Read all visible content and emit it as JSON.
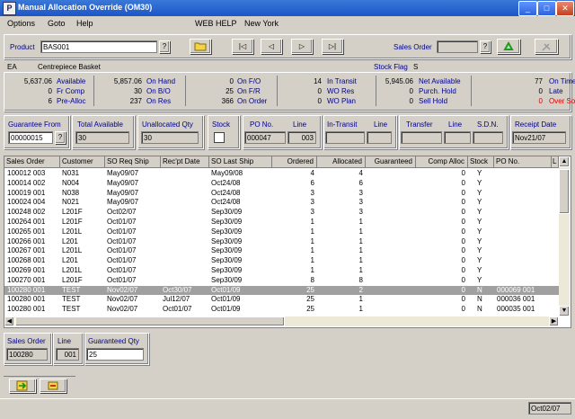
{
  "window": {
    "title": "Manual Allocation Override (OM30)",
    "icon_letter": "P",
    "minimize_glyph": "_",
    "maximize_glyph": "□",
    "close_glyph": "✕"
  },
  "menu": {
    "items": [
      "Options",
      "Goto",
      "Help"
    ],
    "web_help": "WEB HELP",
    "location": "New York"
  },
  "product": {
    "label": "Product",
    "value": "BAS001",
    "lookup": "?",
    "uom": "EA",
    "description": "Centrepiece Basket",
    "stock_flag_label": "Stock Flag",
    "stock_flag_value": "S"
  },
  "sales_order_lookup": {
    "label": "Sales Order",
    "value": "",
    "lookup": "?"
  },
  "nav": {
    "first": "|◁",
    "prev": "◁",
    "next": "▷",
    "last": "▷|"
  },
  "stats": {
    "col1": [
      {
        "value": "5,637.06",
        "label": "Available"
      },
      {
        "value": "0",
        "label": "Fr Comp"
      },
      {
        "value": "6",
        "label": "Pre-Alloc"
      }
    ],
    "col2": [
      {
        "value": "5,857.06",
        "label": "On Hand"
      },
      {
        "value": "30",
        "label": "On B/O"
      },
      {
        "value": "237",
        "label": "On Res"
      }
    ],
    "col3": [
      {
        "value": "0",
        "label": "On F/O"
      },
      {
        "value": "25",
        "label": "On F/R"
      },
      {
        "value": "366",
        "label": "On Order"
      }
    ],
    "col4": [
      {
        "value": "14",
        "label": "In Transit"
      },
      {
        "value": "0",
        "label": "WO Res"
      },
      {
        "value": "0",
        "label": "WO Plan"
      }
    ],
    "col5": [
      {
        "value": "5,945.06",
        "label": "Net Available"
      },
      {
        "value": "0",
        "label": "Purch. Hold"
      },
      {
        "value": "0",
        "label": "Sell Hold"
      }
    ],
    "col6": [
      {
        "value": "77",
        "label": "On Time"
      },
      {
        "value": "0",
        "label": "Late"
      },
      {
        "value": "0",
        "label": "Over Sold"
      }
    ]
  },
  "details": {
    "guarantee_from": {
      "label": "Guarantee From",
      "value": "00000015",
      "lookup": "?"
    },
    "total_available": {
      "label": "Total Available",
      "value": "30"
    },
    "unallocated_qty": {
      "label": "Unallocated Qty",
      "value": "30"
    },
    "stock": {
      "label": "Stock"
    },
    "po_no": {
      "label": "PO No.",
      "value": "000047"
    },
    "po_line": {
      "label": "Line",
      "value": "003"
    },
    "in_transit": {
      "label": "In-Transit",
      "value": ""
    },
    "in_transit_line": {
      "label": "Line",
      "value": ""
    },
    "transfer": {
      "label": "Transfer",
      "value": ""
    },
    "transfer_line": {
      "label": "Line",
      "value": ""
    },
    "sdn": {
      "label": "S.D.N.",
      "value": ""
    },
    "receipt_date": {
      "label": "Receipt Date",
      "value": "Nov21/07"
    }
  },
  "table": {
    "columns": [
      "Sales Order",
      "Customer",
      "SO Req Ship",
      "Rec'pt Date",
      "SO Last Ship",
      "Ordered",
      "Allocated",
      "Guaranteed",
      "Comp Alloc",
      "Stock",
      "PO No.",
      "L"
    ],
    "rows": [
      [
        "100012  003",
        "N031",
        "May09/07",
        "",
        "May09/08",
        "4",
        "4",
        "",
        "0",
        "Y",
        ""
      ],
      [
        "100014  002",
        "N004",
        "May09/07",
        "",
        "Oct24/08",
        "6",
        "6",
        "",
        "0",
        "Y",
        ""
      ],
      [
        "100019  001",
        "N038",
        "May09/07",
        "",
        "Oct24/08",
        "3",
        "3",
        "",
        "0",
        "Y",
        ""
      ],
      [
        "100024  004",
        "N021",
        "May09/07",
        "",
        "Oct24/08",
        "3",
        "3",
        "",
        "0",
        "Y",
        ""
      ],
      [
        "100248  002",
        "L201F",
        "Oct02/07",
        "",
        "Sep30/09",
        "3",
        "3",
        "",
        "0",
        "Y",
        ""
      ],
      [
        "100264  001",
        "L201F",
        "Oct01/07",
        "",
        "Sep30/09",
        "1",
        "1",
        "",
        "0",
        "Y",
        ""
      ],
      [
        "100265  001",
        "L201L",
        "Oct01/07",
        "",
        "Sep30/09",
        "1",
        "1",
        "",
        "0",
        "Y",
        ""
      ],
      [
        "100266  001",
        "L201",
        "Oct01/07",
        "",
        "Sep30/09",
        "1",
        "1",
        "",
        "0",
        "Y",
        ""
      ],
      [
        "100267  001",
        "L201L",
        "Oct01/07",
        "",
        "Sep30/09",
        "1",
        "1",
        "",
        "0",
        "Y",
        ""
      ],
      [
        "100268  001",
        "L201",
        "Oct01/07",
        "",
        "Sep30/09",
        "1",
        "1",
        "",
        "0",
        "Y",
        ""
      ],
      [
        "100269  001",
        "L201L",
        "Oct01/07",
        "",
        "Sep30/09",
        "1",
        "1",
        "",
        "0",
        "Y",
        ""
      ],
      [
        "100270  001",
        "L201F",
        "Oct01/07",
        "",
        "Sep30/09",
        "8",
        "8",
        "",
        "0",
        "Y",
        ""
      ],
      [
        "100280  001",
        "TEST",
        "Nov02/07",
        "Oct30/07",
        "Oct01/09",
        "25",
        "2",
        "",
        "0",
        "N",
        "000069  001"
      ],
      [
        "100280  001",
        "TEST",
        "Nov02/07",
        "Jul12/07",
        "Oct01/09",
        "25",
        "1",
        "",
        "0",
        "N",
        "000036  001"
      ],
      [
        "100280  001",
        "TEST",
        "Nov02/07",
        "Oct01/07",
        "Oct01/09",
        "25",
        "1",
        "",
        "0",
        "N",
        "000035  001"
      ]
    ],
    "selected_row": 12
  },
  "bottom": {
    "sales_order": {
      "label": "Sales Order",
      "value": "100280"
    },
    "line": {
      "label": "Line",
      "value": "001"
    },
    "guaranteed_qty": {
      "label": "Guaranteed Qty",
      "value": "25"
    }
  },
  "status_bar": {
    "date": "Oct02/07"
  },
  "colors": {
    "title_bar": "#1c56c8",
    "accent_blue": "#00008b",
    "red": "#dd0000",
    "selected_row": "#a0a0a0"
  }
}
